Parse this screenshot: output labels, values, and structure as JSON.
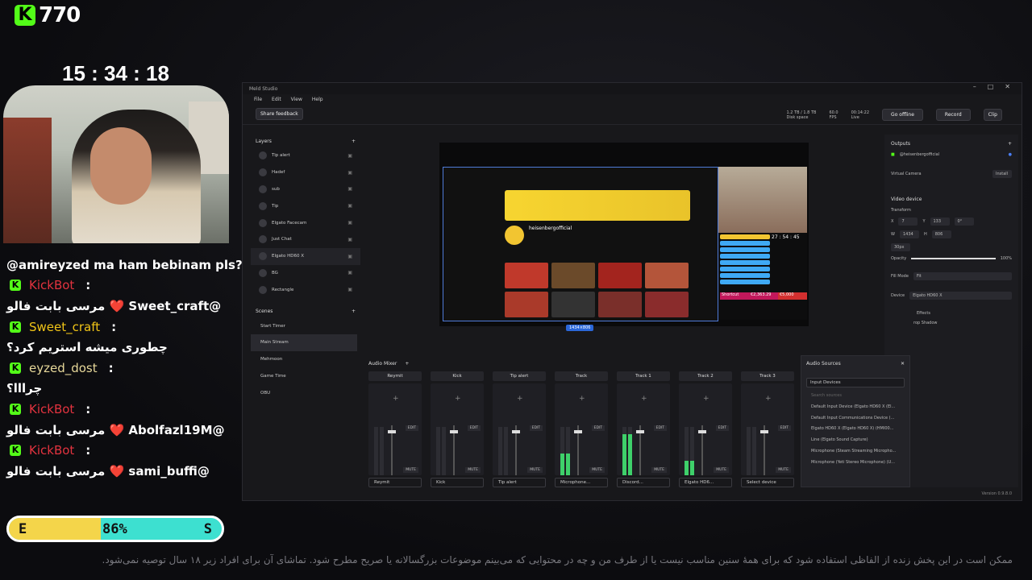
{
  "overlay": {
    "viewer_count": "770",
    "kick_logo_letter": "K",
    "clock": "15 : 34 : 18",
    "progress": {
      "left": "E",
      "right": "S",
      "label": "86%",
      "fraction": 0.43
    },
    "disclaimer": "ممکن است در این پخش زنده از الفاظی استفاده شود که برای همهٔ سنین مناسب نیست یا از طرف من و چه در محتوایی که می‌بینم موضوعات بزرگسالانه یا صریح مطرح شود. تماشای آن برای افراد زیر ۱۸ سال توصیه نمی‌شود."
  },
  "chat": [
    {
      "text": "@amireyzed ma ham bebinam pls?",
      "user": "",
      "color": "#ffffff",
      "badge": false
    },
    {
      "text": ":",
      "user": "KickBot",
      "color": "#e3333f",
      "badge": true
    },
    {
      "text": "مرسی بابت فالو ❤️ Sweet_craft@",
      "user": "",
      "color": "#ffffff",
      "badge": false
    },
    {
      "text": ":",
      "user": "Sweet_craft",
      "color": "#f0c417",
      "badge": true
    },
    {
      "text": "چطوری میشه استریم کرد؟",
      "user": "",
      "color": "#ffffff",
      "badge": false
    },
    {
      "text": ":",
      "user": "eyzed_dost",
      "color": "#e7d89a",
      "badge": true
    },
    {
      "text": "چرااا؟",
      "user": "",
      "color": "#ffffff",
      "badge": false
    },
    {
      "text": ":",
      "user": "KickBot",
      "color": "#e3333f",
      "badge": true
    },
    {
      "text": "مرسی بابت فالو ❤️ Abolfazl19M@",
      "user": "",
      "color": "#ffffff",
      "badge": false
    },
    {
      "text": ":",
      "user": "KickBot",
      "color": "#e3333f",
      "badge": true
    },
    {
      "text": "مرسی بابت فالو ❤️ sami_buffi@",
      "user": "",
      "color": "#ffffff",
      "badge": false
    }
  ],
  "app": {
    "title": "Meld Studio",
    "menu": [
      "File",
      "Edit",
      "View",
      "Help"
    ],
    "share_feedback": "Share feedback",
    "disk": "1.2 TB / 1.8 TB",
    "disk_label": "Disk space",
    "fps": "60.0",
    "fps_label": "FPS",
    "live_time": "00:14:22",
    "live_label": "Live",
    "go_offline": "Go offline",
    "record": "Record",
    "clip": "Clip",
    "layers_title": "Layers",
    "layers": [
      "Tip alert",
      "Hadef",
      "sub",
      "Tip",
      "Elgato Facecam",
      "Just Chat",
      "Elgato HD60 X",
      "BG",
      "Rectangle"
    ],
    "scenes_title": "Scenes",
    "scenes": [
      "Start Timer",
      "Main Stream",
      "Mehmoon",
      "Game Time",
      "OBU"
    ],
    "selected_scene": "Main Stream",
    "size_badge": "1434×806",
    "youtube_channel": "heisenbergofficial",
    "streamer_timer": "27 : 54 : 45",
    "shortcut_label": "Shortcut",
    "shortcut_value1": "€2,363.29",
    "shortcut_value2": "€5,000",
    "outputs_title": "Outputs",
    "output_account": "@heisenbergofficial",
    "virtual_camera": "Virtual Camera",
    "install": "Install",
    "video_device_title": "Video device",
    "transform": "Transform",
    "x": "7",
    "y": "133",
    "rot": "0°",
    "w": "1434",
    "h": "806",
    "corner": "30px",
    "opacity_label": "Opacity",
    "opacity": "100%",
    "fill_mode_label": "Fill Mode",
    "fill_mode": "Fit",
    "device_label": "Device",
    "device": "Elgato HD60 X",
    "effects": "Effects",
    "drop_shadow": "rop Shadow",
    "audio_mixer_title": "Audio Mixer",
    "channels": [
      {
        "name": "Reymit",
        "select": "Reymit",
        "level": 0.0
      },
      {
        "name": "Kick",
        "select": "Kick",
        "level": 0.0
      },
      {
        "name": "Tip alert",
        "select": "Tip alert",
        "level": 0.0
      },
      {
        "name": "Track",
        "select": "Microphone...",
        "level": 0.45
      },
      {
        "name": "Track 1",
        "select": "Discord...",
        "level": 0.85
      },
      {
        "name": "Track 2",
        "select": "Elgato HD6...",
        "level": 0.3
      },
      {
        "name": "Track 3",
        "select": "Select device",
        "level": 0.0
      }
    ],
    "magic_mic": "Magic Mic",
    "edit": "EDIT",
    "mute": "MUTE",
    "audio_sources_title": "Audio Sources",
    "input_devices": "Input Devices",
    "search_sources": "Search sources",
    "audio_sources": [
      "Default Input Device (Elgato HD60 X (El...",
      "Default Input Communications Device (...",
      "Elgato HD60 X (Elgato HD60 X) (HMI00...",
      "Line (Elgato Sound Capture)",
      "Microphone (Steam Streaming Micropho...",
      "Microphone (Yeti Stereo Microphone) (U..."
    ],
    "version": "Version 0.9.8.0"
  }
}
